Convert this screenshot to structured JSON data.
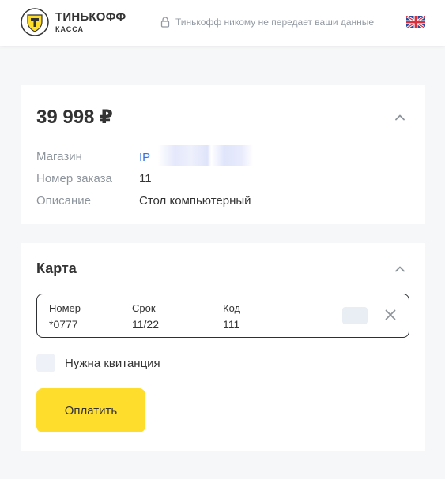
{
  "header": {
    "logo_title": "ТИНЬКОФФ",
    "logo_subtitle": "КАССА",
    "security_note": "Тинькофф никому не передает ваши данные",
    "language_flag": "uk-flag-icon"
  },
  "order": {
    "amount": "39 998 ₽",
    "rows": [
      {
        "label": "Магазин",
        "value": "IP_"
      },
      {
        "label": "Номер заказа",
        "value": "11"
      },
      {
        "label": "Описание",
        "value": "Стол компьютерный"
      }
    ]
  },
  "card": {
    "title": "Карта",
    "number_label": "Номер",
    "number_value": "*0777",
    "expiry_label": "Срок",
    "expiry_value": "11/22",
    "cvc_label": "Код",
    "cvc_value": "111"
  },
  "receipt": {
    "label": "Нужна квитанция"
  },
  "pay_button": {
    "label": "Оплатить"
  },
  "colors": {
    "accent": "#ffdd2d",
    "link": "#336fee",
    "background": "#f6f7f8"
  }
}
